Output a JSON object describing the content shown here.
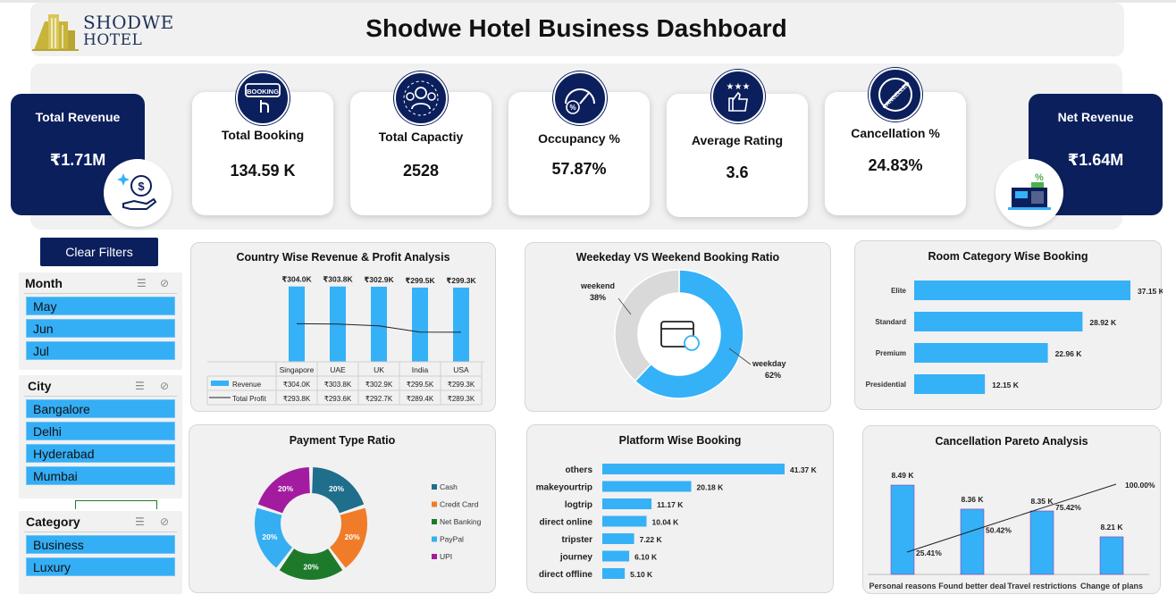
{
  "header": {
    "logo_line1": "SHODWE",
    "logo_line2": "HOTEL",
    "title": "Shodwe Hotel Business  Dashboard"
  },
  "kpis": {
    "total_revenue": {
      "label": "Total Revenue",
      "value": "₹1.71M"
    },
    "total_booking": {
      "label": "Total Booking",
      "value": "134.59 K"
    },
    "total_capacity": {
      "label": "Total Capactiy",
      "value": "2528"
    },
    "occupancy": {
      "label": "Occupancy %",
      "value": "57.87%"
    },
    "average_rating": {
      "label": "Average Rating",
      "value": "3.6"
    },
    "cancellation": {
      "label": "Cancellation %",
      "value": "24.83%"
    },
    "net_revenue": {
      "label": "Net Revenue",
      "value": "₹1.64M"
    }
  },
  "icons": {
    "booking_icon_text": "BOOKING",
    "cancelled_icon_text": "CANCELLED"
  },
  "filters": {
    "clear_label": "Clear Filters",
    "month": {
      "title": "Month",
      "items": [
        "May",
        "Jun",
        "Jul"
      ]
    },
    "city": {
      "title": "City",
      "items": [
        "Bangalore",
        "Delhi",
        "Hyderabad",
        "Mumbai"
      ]
    },
    "category": {
      "title": "Category",
      "items": [
        "Business",
        "Luxury"
      ]
    }
  },
  "colors": {
    "navy": "#0b1f5c",
    "bar_blue": "#35b1f7",
    "cash": "#1f6e8c",
    "credit_card": "#f07c29",
    "net_banking": "#1d7a2a",
    "paypal": "#36aef2",
    "upi": "#a31c9f",
    "weekday": "#35b1f7",
    "weekend": "#d9d9d9"
  },
  "chart_data": [
    {
      "type": "bar",
      "title": "Country Wise Revenue & Profit Analysis",
      "categories": [
        "Singapore",
        "UAE",
        "UK",
        "India",
        "USA"
      ],
      "series": [
        {
          "name": "Revenue",
          "values": [
            304.0,
            303.8,
            302.9,
            299.5,
            299.3
          ],
          "labels": [
            "₹304.0K",
            "₹303.8K",
            "₹302.9K",
            "₹299.5K",
            "₹299.3K"
          ]
        },
        {
          "name": "Total Profit",
          "values": [
            293.8,
            293.6,
            292.7,
            289.4,
            289.3
          ],
          "labels": [
            "₹293.8K",
            "₹293.6K",
            "₹292.7K",
            "₹289.4K",
            "₹289.3K"
          ]
        }
      ]
    },
    {
      "type": "pie",
      "title": "Weekeday VS Weekend Booking Ratio",
      "slices": [
        {
          "name": "weekday",
          "value": 62,
          "label": "62%"
        },
        {
          "name": "weekend",
          "value": 38,
          "label": "38%"
        }
      ]
    },
    {
      "type": "bar",
      "title": "Room Category Wise Booking",
      "categories": [
        "Elite",
        "Standard",
        "Premium",
        "Presidential"
      ],
      "values": [
        37.15,
        28.92,
        22.96,
        12.15
      ],
      "labels": [
        "37.15 K",
        "28.92 K",
        "22.96 K",
        "12.15 K"
      ]
    },
    {
      "type": "pie",
      "title": "Payment Type Ratio",
      "slices": [
        {
          "name": "Cash",
          "value": 20,
          "label": "20%"
        },
        {
          "name": "Credit Card",
          "value": 20,
          "label": "20%"
        },
        {
          "name": "Net Banking",
          "value": 20,
          "label": "20%"
        },
        {
          "name": "PayPal",
          "value": 20,
          "label": "20%"
        },
        {
          "name": "UPI",
          "value": 20,
          "label": "20%"
        }
      ]
    },
    {
      "type": "bar",
      "title": "Platform Wise Booking",
      "categories": [
        "others",
        "makeyourtrip",
        "logtrip",
        "direct online",
        "tripster",
        "journey",
        "direct offline"
      ],
      "values": [
        41.37,
        20.18,
        11.17,
        10.04,
        7.22,
        6.1,
        5.1
      ],
      "labels": [
        "41.37 K",
        "20.18 K",
        "11.17 K",
        "10.04 K",
        "7.22 K",
        "6.10 K",
        "5.10 K"
      ]
    },
    {
      "type": "bar",
      "title": "Cancellation Pareto Analysis",
      "categories": [
        "Personal reasons",
        "Found better deal",
        "Travel restrictions",
        "Change of plans"
      ],
      "values": [
        8.49,
        8.36,
        8.35,
        8.21
      ],
      "labels": [
        "8.49 K",
        "8.36 K",
        "8.35 K",
        "8.21 K"
      ],
      "cumulative": [
        25.41,
        50.42,
        75.42,
        100.0
      ],
      "cumulative_labels": [
        "25.41%",
        "50.42%",
        "75.42%",
        "100.00%"
      ]
    }
  ]
}
